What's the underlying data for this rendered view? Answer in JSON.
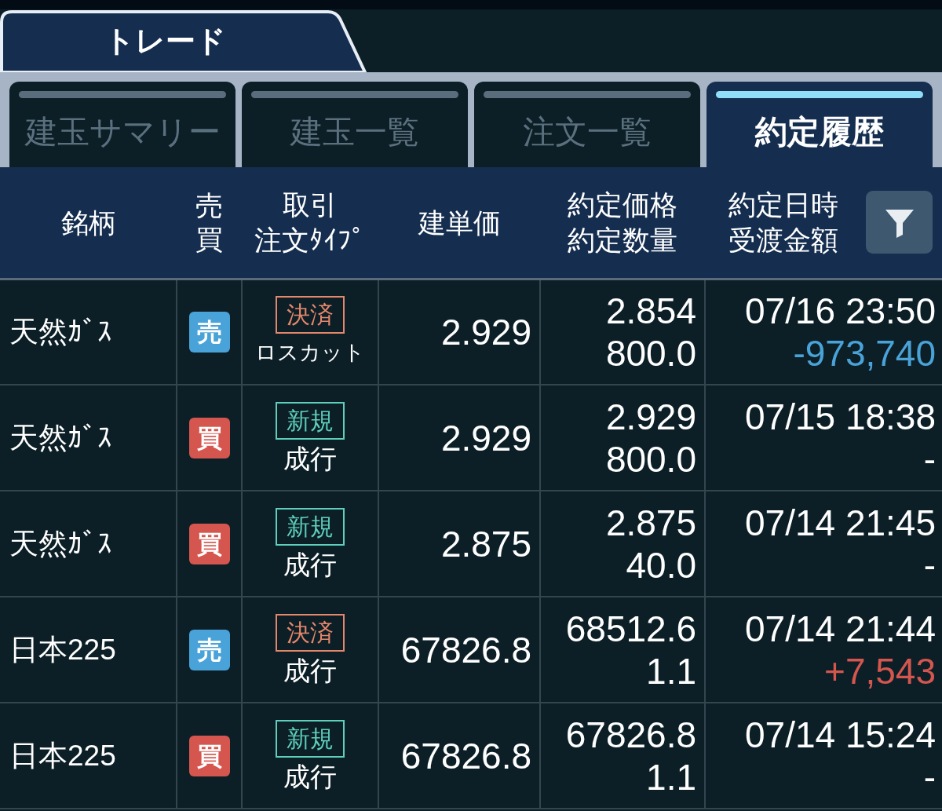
{
  "main_tab": {
    "label": "トレード"
  },
  "tabs": [
    {
      "label": "建玉サマリー",
      "selected": false
    },
    {
      "label": "建玉一覧",
      "selected": false
    },
    {
      "label": "注文一覧",
      "selected": false
    },
    {
      "label": "約定履歴",
      "selected": true
    }
  ],
  "table": {
    "columns": [
      {
        "lines": [
          "銘柄"
        ]
      },
      {
        "lines": [
          "売買"
        ]
      },
      {
        "lines": [
          "取引",
          "注文ﾀｲﾌﾟ"
        ]
      },
      {
        "lines": [
          "建単価"
        ]
      },
      {
        "lines": [
          "約定価格",
          "約定数量"
        ]
      },
      {
        "lines": [
          "約定日時",
          "受渡金額"
        ]
      }
    ],
    "rows": [
      {
        "name": "天然ｶﾞｽ",
        "side": {
          "label": "売",
          "color": "#4aa3d8"
        },
        "trade": {
          "label": "決済",
          "color": "#e5876a"
        },
        "order_type": "ロスカット",
        "unit_price": "2.929",
        "exec_price": "2.854",
        "quantity": "800.0",
        "datetime": "07/16 23:50",
        "amount": {
          "text": "-973,740",
          "color": "#4aa3d8"
        }
      },
      {
        "name": "天然ｶﾞｽ",
        "side": {
          "label": "買",
          "color": "#d4564e"
        },
        "trade": {
          "label": "新規",
          "color": "#5ecfbc"
        },
        "order_type": "成行",
        "unit_price": "2.929",
        "exec_price": "2.929",
        "quantity": "800.0",
        "datetime": "07/15 18:38",
        "amount": {
          "text": "-",
          "color": "#ffffff"
        }
      },
      {
        "name": "天然ｶﾞｽ",
        "side": {
          "label": "買",
          "color": "#d4564e"
        },
        "trade": {
          "label": "新規",
          "color": "#5ecfbc"
        },
        "order_type": "成行",
        "unit_price": "2.875",
        "exec_price": "2.875",
        "quantity": "40.0",
        "datetime": "07/14 21:45",
        "amount": {
          "text": "-",
          "color": "#ffffff"
        }
      },
      {
        "name": "日本225",
        "side": {
          "label": "売",
          "color": "#4aa3d8"
        },
        "trade": {
          "label": "決済",
          "color": "#e5876a"
        },
        "order_type": "成行",
        "unit_price": "67826.8",
        "exec_price": "68512.6",
        "quantity": "1.1",
        "datetime": "07/14 21:44",
        "amount": {
          "text": "+7,543",
          "color": "#d4564e"
        }
      },
      {
        "name": "日本225",
        "side": {
          "label": "買",
          "color": "#d4564e"
        },
        "trade": {
          "label": "新規",
          "color": "#5ecfbc"
        },
        "order_type": "成行",
        "unit_price": "67826.8",
        "exec_price": "67826.8",
        "quantity": "1.1",
        "datetime": "07/14 15:24",
        "amount": {
          "text": "-",
          "color": "#ffffff"
        }
      }
    ]
  }
}
